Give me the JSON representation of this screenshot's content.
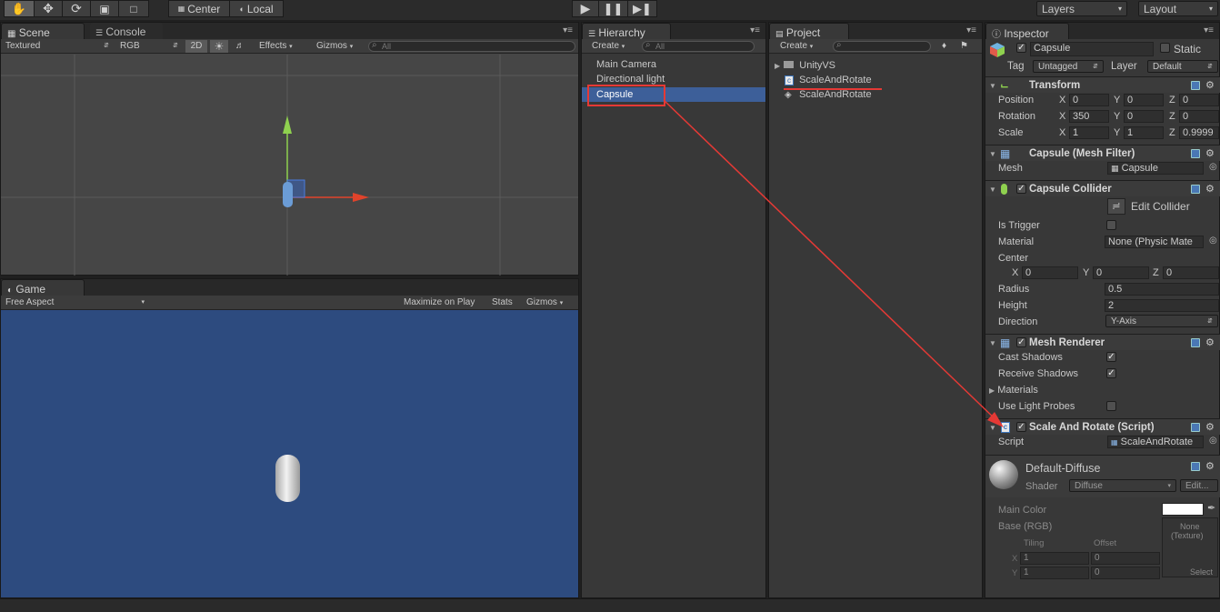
{
  "toolbar": {
    "pivot_center": "Center",
    "pivot_local": "Local",
    "layers": "Layers",
    "layout": "Layout"
  },
  "scene": {
    "tab": "Scene",
    "console_tab": "Console",
    "shading": "Textured",
    "render_mode": "RGB",
    "mode_2d": "2D",
    "effects": "Effects",
    "gizmos": "Gizmos",
    "search_placeholder": "All"
  },
  "game": {
    "tab": "Game",
    "aspect": "Free Aspect",
    "maximize": "Maximize on Play",
    "stats": "Stats",
    "gizmos": "Gizmos",
    "background_color": "#2d4b7f"
  },
  "hierarchy": {
    "tab": "Hierarchy",
    "create": "Create",
    "search_placeholder": "All",
    "items": [
      "Main Camera",
      "Directional light",
      "Capsule"
    ],
    "selected_index": 2
  },
  "project": {
    "tab": "Project",
    "create": "Create",
    "items": [
      "UnityVS",
      "ScaleAndRotate",
      "ScaleAndRotate"
    ]
  },
  "inspector": {
    "tab": "Inspector",
    "object_name": "Capsule",
    "static_label": "Static",
    "tag_label": "Tag",
    "tag_value": "Untagged",
    "layer_label": "Layer",
    "layer_value": "Default",
    "transform": {
      "title": "Transform",
      "position_label": "Position",
      "rotation_label": "Rotation",
      "scale_label": "Scale",
      "position": [
        "0",
        "0",
        "0"
      ],
      "rotation": [
        "350",
        "0",
        "0"
      ],
      "scale": [
        "1",
        "1",
        "0.9999"
      ]
    },
    "axis": {
      "x": "X",
      "y": "Y",
      "z": "Z"
    },
    "mesh_filter": {
      "title": "Capsule (Mesh Filter)",
      "mesh_label": "Mesh",
      "mesh_value": "Capsule"
    },
    "collider": {
      "title": "Capsule Collider",
      "edit_collider": "Edit Collider",
      "is_trigger_label": "Is Trigger",
      "material_label": "Material",
      "material_value": "None (Physic Mate",
      "center_label": "Center",
      "center": [
        "0",
        "0",
        "0"
      ],
      "radius_label": "Radius",
      "radius_value": "0.5",
      "height_label": "Height",
      "height_value": "2",
      "direction_label": "Direction",
      "direction_value": "Y-Axis"
    },
    "mesh_renderer": {
      "title": "Mesh Renderer",
      "cast_shadows_label": "Cast Shadows",
      "receive_shadows_label": "Receive Shadows",
      "materials_label": "Materials",
      "light_probes_label": "Use Light Probes"
    },
    "script_comp": {
      "title": "Scale And Rotate (Script)",
      "script_label": "Script",
      "script_value": "ScaleAndRotate"
    },
    "material": {
      "name": "Default-Diffuse",
      "shader_label": "Shader",
      "shader_value": "Diffuse",
      "edit": "Edit...",
      "main_color_label": "Main Color",
      "base_label": "Base (RGB)",
      "texture_none": "None",
      "texture_type": "(Texture)",
      "tiling_label": "Tiling",
      "offset_label": "Offset",
      "tiling": [
        "1",
        "1"
      ],
      "offset": [
        "0",
        "0"
      ],
      "select": "Select"
    }
  },
  "colors": {
    "selection": "#3d5f99",
    "annotation_red": "#e53935"
  }
}
